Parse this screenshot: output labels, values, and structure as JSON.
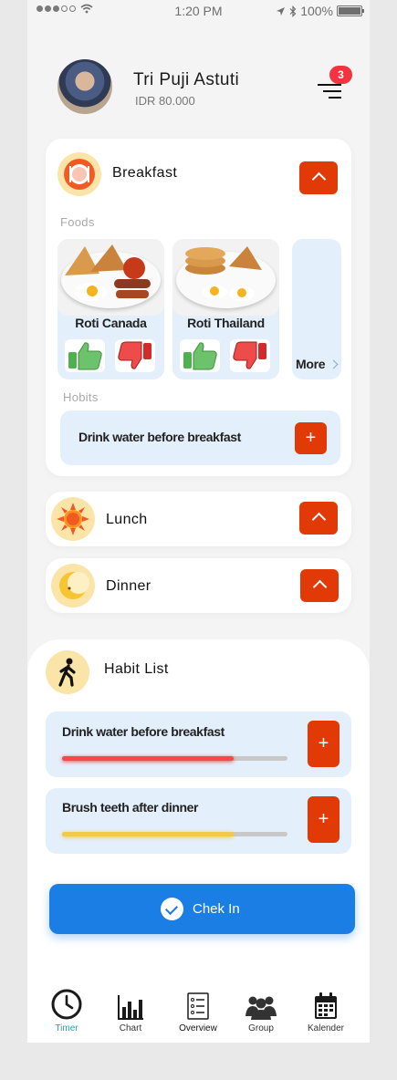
{
  "status_bar": {
    "time": "1:20 PM",
    "battery": "100%"
  },
  "user": {
    "name": "Tri Puji Astuti",
    "balance": "IDR 80.000"
  },
  "notifications": {
    "count": "3"
  },
  "breakfast": {
    "title": "Breakfast",
    "foods_label": "Foods",
    "foods": [
      {
        "name": "Roti Canada"
      },
      {
        "name": "Roti Thailand"
      }
    ],
    "more_label": "More",
    "habits_label": "Hobits",
    "habit": "Drink water before breakfast"
  },
  "lunch": {
    "title": "Lunch"
  },
  "dinner": {
    "title": "Dinner"
  },
  "habit_list": {
    "title": "Habit List",
    "items": [
      {
        "label": "Drink water before breakfast",
        "progress": 0.76,
        "color": "#f4484c"
      },
      {
        "label": "Brush teeth  after dinner",
        "progress": 0.76,
        "color": "#f2c94c"
      }
    ]
  },
  "checkin": {
    "label": "Chek In"
  },
  "tabs": [
    {
      "label": "Timer",
      "icon": "clock-icon",
      "active": false
    },
    {
      "label": "Chart",
      "icon": "bar-chart-icon",
      "active": false
    },
    {
      "label": "Overview",
      "icon": "checklist-icon",
      "active": true
    },
    {
      "label": "Group",
      "icon": "group-icon",
      "active": false
    },
    {
      "label": "Kalender",
      "icon": "calendar-icon",
      "active": false
    }
  ],
  "colors": {
    "accent": "#e23a06",
    "primary": "#1a7ee4",
    "tab_active": "#2a9da0"
  }
}
